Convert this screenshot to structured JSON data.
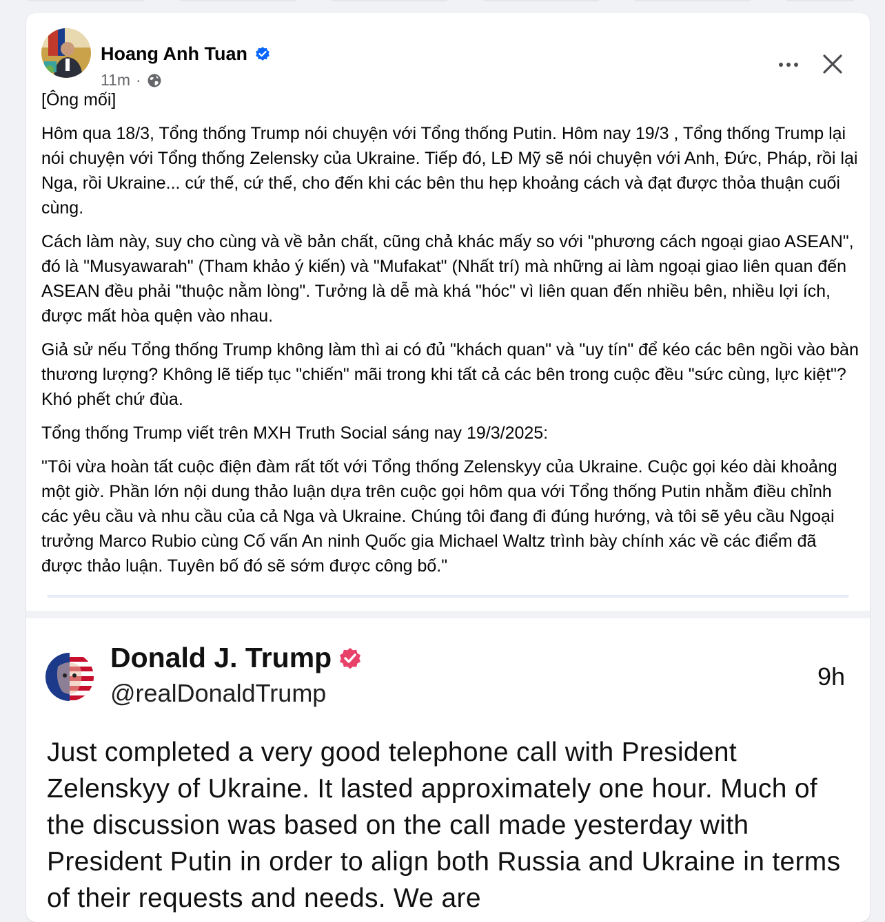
{
  "post": {
    "author": "Hoang Anh Tuan",
    "time": "11m",
    "separator": "·",
    "paragraphs": [
      "[Ông mối]",
      "Hôm qua 18/3, Tổng thống Trump nói chuyện với Tổng thống Putin. Hôm nay 19/3 , Tổng thống Trump lại nói chuyện với Tổng thống Zelensky của Ukraine. Tiếp đó, LĐ Mỹ sẽ nói chuyện với Anh, Đức, Pháp, rồi lại Nga, rồi Ukraine... cứ thế, cứ thế, cho đến khi các bên thu hẹp khoảng cách và đạt được thỏa thuận cuối cùng.",
      "Cách làm này, suy cho cùng và về bản chất, cũng chả khác mấy so với \"phương cách ngoại giao ASEAN\", đó là \"Musyawarah\" (Tham khảo ý kiến) và \"Mufakat\" (Nhất trí) mà những ai làm ngoại giao liên quan đến ASEAN đều phải \"thuộc nằm lòng\".  Tưởng là dễ mà khá \"hóc\" vì liên quan đến nhiều bên, nhiều lợi ích, được mất hòa quện vào nhau.",
      "Giả sử nếu Tổng thống Trump không làm thì ai có đủ \"khách quan\" và \"uy tín\" để kéo các bên ngồi vào bàn thương lượng? Không lẽ tiếp tục \"chiến\" mãi trong khi tất cả các bên trong cuộc đều \"sức cùng, lực kiệt\"? Khó phết chứ đùa.",
      "Tổng thống Trump viết trên MXH Truth Social sáng nay 19/3/2025:",
      "\"Tôi vừa hoàn tất cuộc điện đàm rất tốt với Tổng thống Zelenskyy của Ukraine. Cuộc gọi kéo dài khoảng một giờ. Phần lớn nội dung thảo luận dựa trên cuộc gọi hôm qua với Tổng thống Putin nhằm điều chỉnh các yêu cầu và nhu cầu của cả Nga và Ukraine. Chúng tôi đang đi đúng hướng, và tôi sẽ yêu cầu Ngoại trưởng Marco Rubio cùng Cố vấn An ninh Quốc gia Michael Waltz trình bày chính xác về các điểm đã được thảo luận. Tuyên bố đó sẽ sớm được công bố.\""
    ],
    "icons": {
      "verified": "verified-badge-icon",
      "audience": "globe-icon",
      "more": "more-options-icon",
      "close": "close-icon"
    },
    "accent_color": "#0866ff"
  },
  "embed": {
    "name": "Donald J. Trump",
    "handle": "@realDonaldTrump",
    "time": "9h",
    "text": "Just completed a very good telephone call with President Zelenskyy of Ukraine. It lasted approximately one hour. Much of the discussion was based on the call made yesterday with President Putin in order to align both Russia and Ukraine in terms of their requests and needs. We are",
    "badge_color": "#e8426b"
  }
}
